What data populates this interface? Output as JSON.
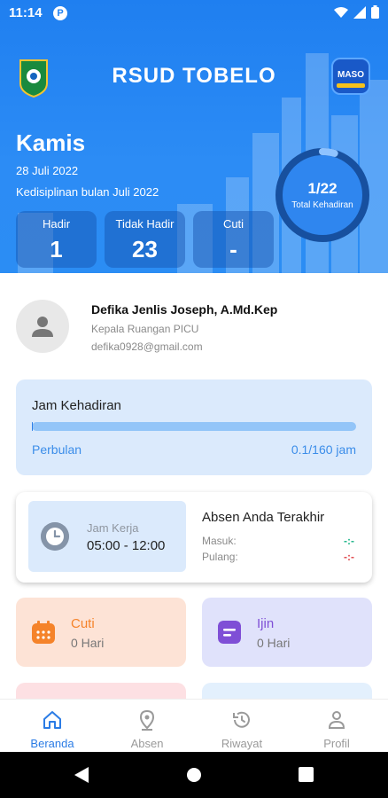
{
  "status_bar": {
    "time": "11:14",
    "notification_badge": "P"
  },
  "header": {
    "app_title": "RSUD TOBELO",
    "right_logo_text": "MASO",
    "day": "Kamis",
    "date": "28 Juli 2022",
    "discipline_label": "Kedisiplinan bulan Juli 2022",
    "stats": [
      {
        "label": "Hadir",
        "value": "1"
      },
      {
        "label": "Tidak Hadir",
        "value": "23"
      },
      {
        "label": "Cuti",
        "value": "-"
      }
    ],
    "ring": {
      "value": "1/22",
      "label": "Total Kehadiran",
      "fraction": 0.045
    }
  },
  "profile": {
    "name": "Defika Jenlis Joseph, A.Md.Kep",
    "role": "Kepala Ruangan PICU",
    "email": "defika0928@gmail.com"
  },
  "jam_kehadiran": {
    "title": "Jam Kehadiran",
    "period_label": "Perbulan",
    "value": "0.1/160 jam",
    "progress_fraction": 0.000625
  },
  "absen": {
    "jam_kerja_label": "Jam Kerja",
    "jam_kerja_value": "05:00 - 12:00",
    "title": "Absen Anda Terakhir",
    "masuk_label": "Masuk:",
    "masuk_value": "-:-",
    "pulang_label": "Pulang:",
    "pulang_value": "-:-"
  },
  "tiles": [
    {
      "title": "Cuti",
      "subtitle": "0 Hari",
      "icon": "calendar-icon"
    },
    {
      "title": "Ijin",
      "subtitle": "0 Hari",
      "icon": "note-icon"
    }
  ],
  "bottom_nav": [
    {
      "label": "Beranda",
      "icon": "home-icon",
      "active": true
    },
    {
      "label": "Absen",
      "icon": "location-icon",
      "active": false
    },
    {
      "label": "Riwayat",
      "icon": "history-icon",
      "active": false
    },
    {
      "label": "Profil",
      "icon": "person-icon",
      "active": false
    }
  ],
  "colors": {
    "primary": "#2383f2",
    "cuti_accent": "#f5832a",
    "ijin_accent": "#7f4fd6",
    "masuk": "#1fb58a",
    "pulang": "#e0474c"
  }
}
